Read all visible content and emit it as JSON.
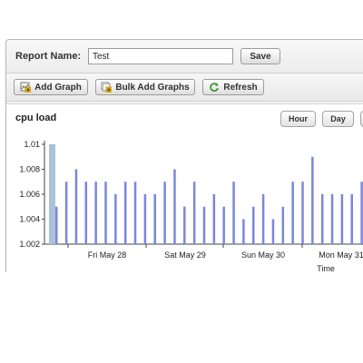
{
  "report": {
    "name_label": "Report Name:",
    "name_value": "Test",
    "save_label": "Save"
  },
  "toolbar": {
    "add_graph_label": "Add Graph",
    "bulk_add_label": "Bulk Add Graphs",
    "refresh_label": "Refresh"
  },
  "graph": {
    "title": "cpu load",
    "range_buttons": [
      "Hour",
      "Day"
    ]
  },
  "colors": {
    "bar": "#7b86df",
    "bar_highlight": "#a9c2d8"
  },
  "chart_data": {
    "type": "bar",
    "title": "cpu load",
    "xlabel": "Time",
    "ylabel": "",
    "ylim": [
      1.002,
      1.01
    ],
    "yticks": [
      "1.01",
      "1.008",
      "1.006",
      "1.004",
      "1.002"
    ],
    "xticks": [
      "Fri May 28",
      "Sat May 29",
      "Sun May 30",
      "Mon May 31"
    ],
    "values": [
      1.005,
      1.007,
      1.008,
      1.007,
      1.007,
      1.007,
      1.006,
      1.007,
      1.007,
      1.006,
      1.006,
      1.007,
      1.008,
      1.005,
      1.007,
      1.005,
      1.006,
      1.005,
      1.007,
      1.004,
      1.005,
      1.006,
      1.004,
      1.005,
      1.007,
      1.007,
      1.009,
      1.006,
      1.006,
      1.006,
      1.006,
      1.007
    ],
    "grid": false,
    "legend": "none"
  }
}
